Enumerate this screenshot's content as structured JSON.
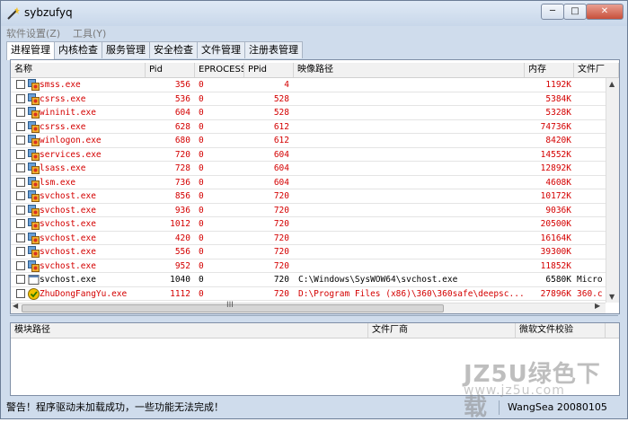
{
  "window": {
    "title": "sybzufyq"
  },
  "titlebar_controls": {
    "minimize": "─",
    "maximize": "□",
    "close": "✕"
  },
  "menu": [
    "软件设置(Z)",
    "工具(Y)"
  ],
  "tabs": [
    "进程管理",
    "内核检查",
    "服务管理",
    "安全检查",
    "文件管理",
    "注册表管理"
  ],
  "process_table": {
    "columns": [
      "名称",
      "Pid",
      "EPROCESS",
      "PPid",
      "映像路径",
      "内存",
      "文件厂"
    ],
    "rows": [
      {
        "name": "smss.exe",
        "pid": "356",
        "eprocess": "0",
        "ppid": "4",
        "path": "",
        "mem": "1192K",
        "vendor": "",
        "red": true
      },
      {
        "name": "csrss.exe",
        "pid": "536",
        "eprocess": "0",
        "ppid": "528",
        "path": "",
        "mem": "5384K",
        "vendor": "",
        "red": true
      },
      {
        "name": "wininit.exe",
        "pid": "604",
        "eprocess": "0",
        "ppid": "528",
        "path": "",
        "mem": "5328K",
        "vendor": "",
        "red": true
      },
      {
        "name": "csrss.exe",
        "pid": "628",
        "eprocess": "0",
        "ppid": "612",
        "path": "",
        "mem": "74736K",
        "vendor": "",
        "red": true
      },
      {
        "name": "winlogon.exe",
        "pid": "680",
        "eprocess": "0",
        "ppid": "612",
        "path": "",
        "mem": "8420K",
        "vendor": "",
        "red": true
      },
      {
        "name": "services.exe",
        "pid": "720",
        "eprocess": "0",
        "ppid": "604",
        "path": "",
        "mem": "14552K",
        "vendor": "",
        "red": true
      },
      {
        "name": "lsass.exe",
        "pid": "728",
        "eprocess": "0",
        "ppid": "604",
        "path": "",
        "mem": "12892K",
        "vendor": "",
        "red": true
      },
      {
        "name": "lsm.exe",
        "pid": "736",
        "eprocess": "0",
        "ppid": "604",
        "path": "",
        "mem": "4608K",
        "vendor": "",
        "red": true
      },
      {
        "name": "svchost.exe",
        "pid": "856",
        "eprocess": "0",
        "ppid": "720",
        "path": "",
        "mem": "10172K",
        "vendor": "",
        "red": true
      },
      {
        "name": "svchost.exe",
        "pid": "936",
        "eprocess": "0",
        "ppid": "720",
        "path": "",
        "mem": "9036K",
        "vendor": "",
        "red": true
      },
      {
        "name": "svchost.exe",
        "pid": "1012",
        "eprocess": "0",
        "ppid": "720",
        "path": "",
        "mem": "20500K",
        "vendor": "",
        "red": true
      },
      {
        "name": "svchost.exe",
        "pid": "420",
        "eprocess": "0",
        "ppid": "720",
        "path": "",
        "mem": "16164K",
        "vendor": "",
        "red": true
      },
      {
        "name": "svchost.exe",
        "pid": "556",
        "eprocess": "0",
        "ppid": "720",
        "path": "",
        "mem": "39300K",
        "vendor": "",
        "red": true
      },
      {
        "name": "svchost.exe",
        "pid": "952",
        "eprocess": "0",
        "ppid": "720",
        "path": "",
        "mem": "11852K",
        "vendor": "",
        "red": true
      },
      {
        "name": "svchost.exe",
        "pid": "1040",
        "eprocess": "0",
        "ppid": "720",
        "path": "C:\\Windows\\SysWOW64\\svchost.exe",
        "mem": "6580K",
        "vendor": "Micro",
        "red": false
      },
      {
        "name": "ZhuDongFangYu.exe",
        "pid": "1112",
        "eprocess": "0",
        "ppid": "720",
        "path": "D:\\Program Files (x86)\\360\\360safe\\deepsc...",
        "mem": "27896K",
        "vendor": "360.c",
        "red": true
      }
    ]
  },
  "scrollbar_grip": "III",
  "module_table": {
    "columns": [
      "模块路径",
      "文件厂商",
      "微软文件校验"
    ]
  },
  "status": {
    "left": "警告！程序驱动未加载成功，一些功能无法完成！",
    "right": "WangSea 20080105"
  },
  "watermark": {
    "line1": "JZ5U绿色下载",
    "line2": "www.jz5u.com"
  },
  "colors": {
    "warning_text": "#d40000",
    "window_frame": "#cfdcec"
  }
}
